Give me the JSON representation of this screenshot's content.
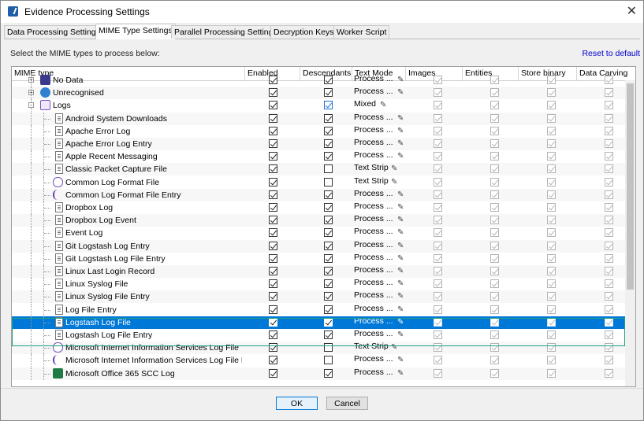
{
  "window": {
    "title": "Evidence Processing Settings"
  },
  "tabs": [
    {
      "label": "Data Processing Settings",
      "active": false
    },
    {
      "label": "MIME Type Settings",
      "active": true
    },
    {
      "label": "Parallel Processing Settings",
      "active": false
    },
    {
      "label": "Decryption Keys",
      "active": false
    },
    {
      "label": "Worker Script",
      "active": false
    }
  ],
  "prompt": "Select the MIME types to process below:",
  "reset_label": "Reset to default",
  "columns": [
    "MIME type",
    "Enabled",
    "Descendants",
    "Text Mode",
    "Images",
    "Entities",
    "Store binary",
    "Data Carving"
  ],
  "rows": [
    {
      "name": "No Data",
      "level": 0,
      "icon": "nodata",
      "enabled": true,
      "desc": true,
      "mode": "Process ...",
      "expander": "+"
    },
    {
      "name": "Unrecognised",
      "level": 0,
      "icon": "unknown",
      "enabled": true,
      "desc": true,
      "mode": "Process ...",
      "expander": "+"
    },
    {
      "name": "Logs",
      "level": 0,
      "icon": "logs",
      "enabled": true,
      "desc": true,
      "descBlue": true,
      "mode": "Mixed",
      "expander": "-"
    },
    {
      "name": "Android System Downloads",
      "level": 1,
      "icon": "file",
      "enabled": true,
      "desc": true,
      "mode": "Process ..."
    },
    {
      "name": "Apache Error Log",
      "level": 1,
      "icon": "file",
      "enabled": true,
      "desc": true,
      "mode": "Process ..."
    },
    {
      "name": "Apache Error Log Entry",
      "level": 1,
      "icon": "file",
      "enabled": true,
      "desc": true,
      "mode": "Process ..."
    },
    {
      "name": "Apple Recent Messaging",
      "level": 1,
      "icon": "file",
      "enabled": true,
      "desc": true,
      "mode": "Process ..."
    },
    {
      "name": "Classic Packet Capture File",
      "level": 1,
      "icon": "file",
      "enabled": true,
      "desc": false,
      "mode": "Text Strip"
    },
    {
      "name": "Common Log Format File",
      "level": 1,
      "icon": "purple",
      "enabled": true,
      "desc": false,
      "mode": "Text Strip"
    },
    {
      "name": "Common Log Format File Entry",
      "level": 1,
      "icon": "purple2",
      "enabled": true,
      "desc": true,
      "mode": "Process ..."
    },
    {
      "name": "Dropbox Log",
      "level": 1,
      "icon": "file",
      "enabled": true,
      "desc": true,
      "mode": "Process ..."
    },
    {
      "name": "Dropbox Log Event",
      "level": 1,
      "icon": "file",
      "enabled": true,
      "desc": true,
      "mode": "Process ..."
    },
    {
      "name": "Event Log",
      "level": 1,
      "icon": "file",
      "enabled": true,
      "desc": true,
      "mode": "Process ..."
    },
    {
      "name": "Git Logstash Log Entry",
      "level": 1,
      "icon": "file",
      "enabled": true,
      "desc": true,
      "mode": "Process ..."
    },
    {
      "name": "Git Logstash Log File Entry",
      "level": 1,
      "icon": "file",
      "enabled": true,
      "desc": true,
      "mode": "Process ..."
    },
    {
      "name": "Linux Last Login Record",
      "level": 1,
      "icon": "file",
      "enabled": true,
      "desc": true,
      "mode": "Process ..."
    },
    {
      "name": "Linux Syslog File",
      "level": 1,
      "icon": "file",
      "enabled": true,
      "desc": true,
      "mode": "Process ..."
    },
    {
      "name": "Linux Syslog File Entry",
      "level": 1,
      "icon": "file",
      "enabled": true,
      "desc": true,
      "mode": "Process ..."
    },
    {
      "name": "Log File Entry",
      "level": 1,
      "icon": "file",
      "enabled": true,
      "desc": true,
      "mode": "Process ..."
    },
    {
      "name": "Logstash Log File",
      "level": 1,
      "icon": "file",
      "enabled": true,
      "desc": true,
      "mode": "Process ...",
      "selected": true
    },
    {
      "name": "Logstash Log File Entry",
      "level": 1,
      "icon": "file",
      "enabled": true,
      "desc": true,
      "mode": "Process ..."
    },
    {
      "name": "Microsoft Internet Information Services Log File",
      "level": 1,
      "icon": "purple",
      "enabled": true,
      "desc": false,
      "mode": "Text Strip"
    },
    {
      "name": "Microsoft Internet Information Services Log File Entr",
      "level": 1,
      "icon": "purple2",
      "enabled": true,
      "desc": false,
      "mode": "Process ..."
    },
    {
      "name": "Microsoft Office 365 SCC Log",
      "level": 1,
      "icon": "excel",
      "enabled": true,
      "desc": true,
      "mode": "Process ..."
    }
  ],
  "buttons": {
    "ok": "OK",
    "cancel": "Cancel"
  }
}
